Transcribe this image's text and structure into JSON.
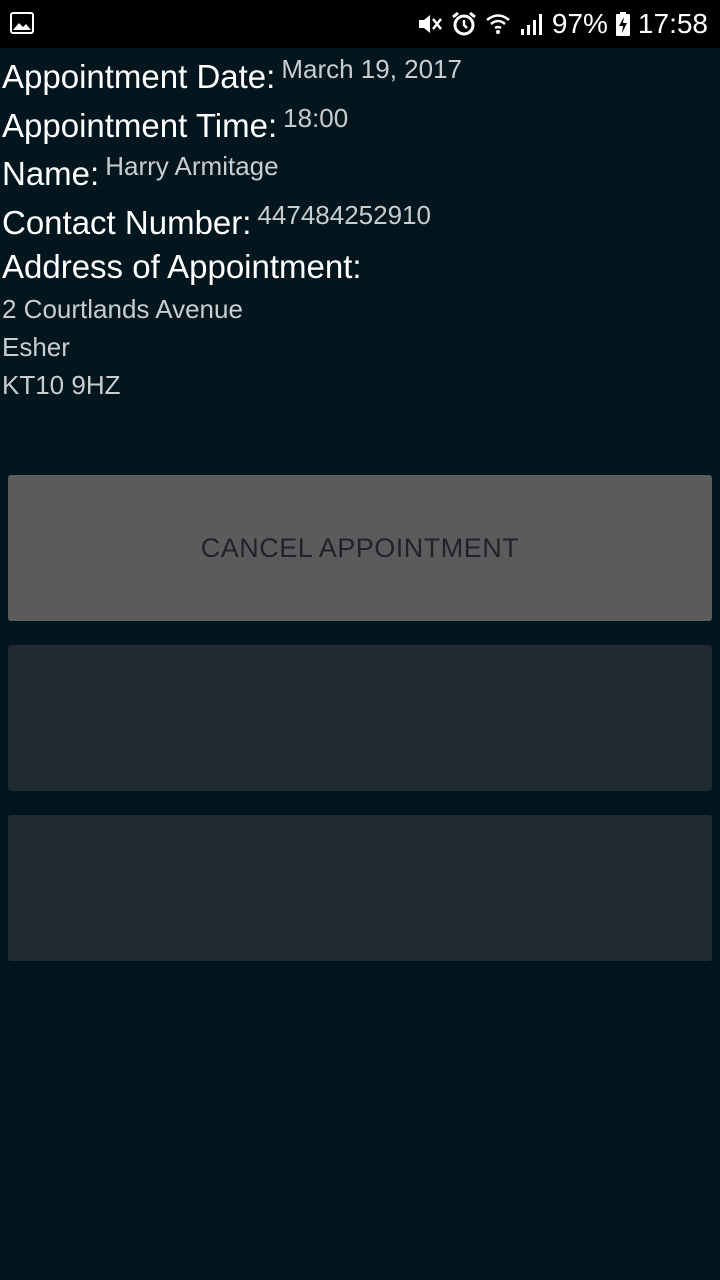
{
  "status_bar": {
    "battery": "97%",
    "time": "17:58",
    "icons": [
      "image-icon",
      "mute-icon",
      "alarm-icon",
      "wifi-icon",
      "signal-icon",
      "battery-charging-icon"
    ]
  },
  "appointment": {
    "date_label": "Appointment Date:",
    "date_value": "March 19, 2017",
    "time_label": "Appointment Time:",
    "time_value": "18:00",
    "name_label": "Name:",
    "name_value": "Harry Armitage",
    "contact_label": "Contact Number:",
    "contact_value": "447484252910",
    "address_label": "Address of Appointment:",
    "address_lines": [
      "2 Courtlands Avenue",
      "Esher",
      "KT10 9HZ"
    ]
  },
  "buttons": {
    "cancel_label": "CANCEL APPOINTMENT",
    "button2_label": "",
    "button3_label": ""
  },
  "colors": {
    "background": "#03161e",
    "cancel_button": "#5b5b5d",
    "disabled_button": "#1f2a31"
  }
}
